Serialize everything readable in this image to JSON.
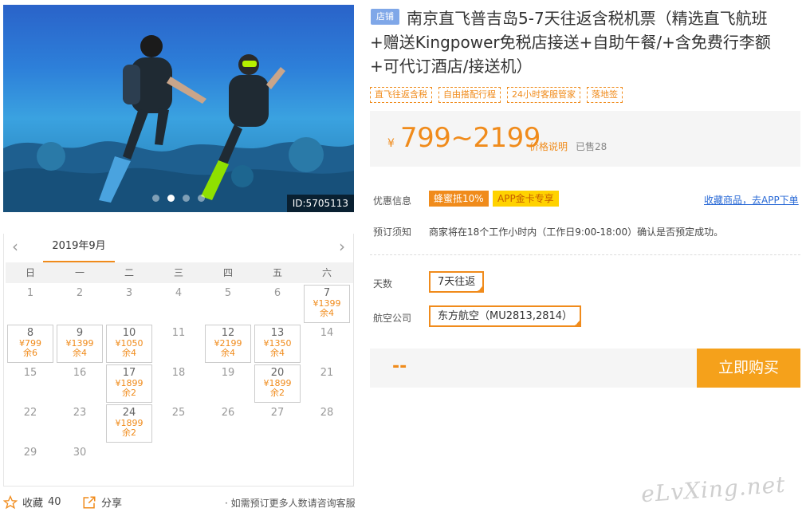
{
  "gallery": {
    "image_id": "ID:5705113",
    "slide_count": 4,
    "active_slide": 1
  },
  "product": {
    "shop_badge": "店铺",
    "title": "南京直飞普吉岛5-7天往返含税机票（精选直飞航班+赠送Kingpower免税店接送+自助午餐/+含免费行李额+可代订酒店/接送机）",
    "tags": [
      "直飞往返含税",
      "自由搭配行程",
      "24小时客服管家",
      "落地签"
    ],
    "currency": "¥",
    "price_range": "799~2199",
    "price_note": "价格说明",
    "sold": "已售28"
  },
  "info": {
    "promo_label": "优惠信息",
    "promo_badge": "蜂蜜抵10%",
    "app_badge": "APP金卡专享",
    "fav_app_link": "收藏商品，去APP下单",
    "notice_label": "预订须知",
    "notice_text": "商家将在18个工作小时内（工作日9:00-18:00）确认是否预定成功。"
  },
  "options": {
    "days_label": "天数",
    "days_value": "7天往返",
    "airline_label": "航空公司",
    "airline_value": "东方航空（MU2813,2814）"
  },
  "purchase": {
    "total": "--",
    "buy_label": "立即购买"
  },
  "calendar": {
    "month": "2019年9月",
    "prev_icon": "‹",
    "next_icon": "›",
    "weekdays": [
      "日",
      "一",
      "二",
      "三",
      "四",
      "五",
      "六"
    ],
    "days": [
      {
        "d": "1"
      },
      {
        "d": "2"
      },
      {
        "d": "3"
      },
      {
        "d": "4"
      },
      {
        "d": "5"
      },
      {
        "d": "6"
      },
      {
        "d": "7",
        "price": "¥1399",
        "left": "余4"
      },
      {
        "d": "8",
        "price": "¥799",
        "left": "余6"
      },
      {
        "d": "9",
        "price": "¥1399",
        "left": "余4"
      },
      {
        "d": "10",
        "price": "¥1050",
        "left": "余4"
      },
      {
        "d": "11"
      },
      {
        "d": "12",
        "price": "¥2199",
        "left": "余4"
      },
      {
        "d": "13",
        "price": "¥1350",
        "left": "余4"
      },
      {
        "d": "14"
      },
      {
        "d": "15"
      },
      {
        "d": "16"
      },
      {
        "d": "17",
        "price": "¥1899",
        "left": "余2"
      },
      {
        "d": "18"
      },
      {
        "d": "19"
      },
      {
        "d": "20",
        "price": "¥1899",
        "left": "余2"
      },
      {
        "d": "21"
      },
      {
        "d": "22"
      },
      {
        "d": "23"
      },
      {
        "d": "24",
        "price": "¥1899",
        "left": "余2"
      },
      {
        "d": "25"
      },
      {
        "d": "26"
      },
      {
        "d": "27"
      },
      {
        "d": "28"
      },
      {
        "d": "29"
      },
      {
        "d": "30"
      }
    ]
  },
  "footer": {
    "favorite_label": "收藏",
    "favorite_count": "40",
    "share_label": "分享",
    "consult_text": "· 如需预订更多人数请咨询客服"
  },
  "watermark": "eLvXing.net",
  "colors": {
    "accent": "#f08b1b",
    "buy_button": "#f5a11b",
    "shop_badge": "#7fa7e8",
    "link": "#2a6ad6"
  }
}
